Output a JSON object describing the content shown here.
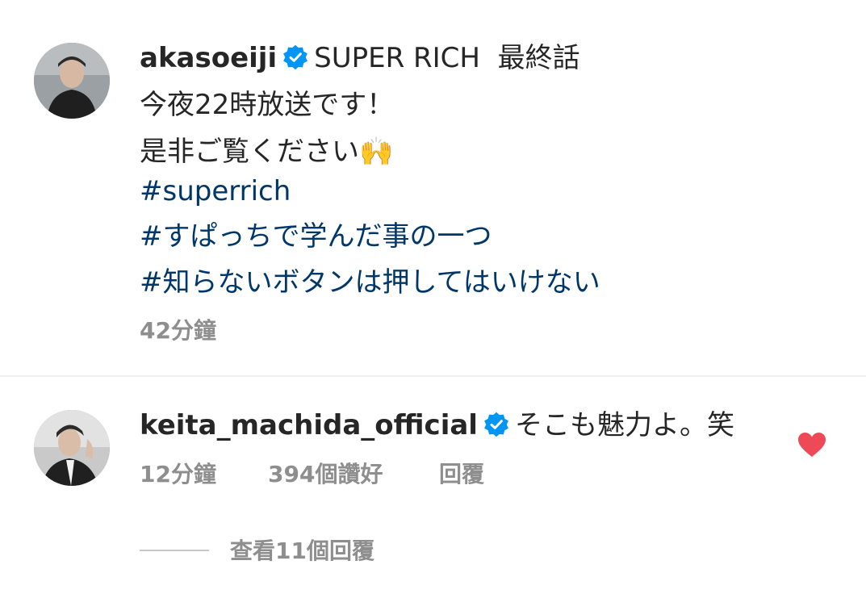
{
  "caption": {
    "username": "akasoeiji",
    "title_text": "SUPER RICH  最終話",
    "line2": "今夜22時放送です！",
    "line3": "是非ご覧ください🙌",
    "hashtags": [
      "#superrich",
      "#すぱっちで学んだ事の一つ",
      "#知らないボタンは押してはいけない"
    ],
    "time": "42分鐘"
  },
  "comment": {
    "username": "keita_machida_official",
    "text": "そこも魅力よ。笑",
    "time": "12分鐘",
    "likes": "394個讚好",
    "reply_label": "回覆",
    "view_replies": "查看11個回覆"
  },
  "colors": {
    "text": "#262626",
    "hashtag": "#00376b",
    "meta": "#8e8e8e",
    "verified": "#0095f6",
    "heart": "#ed4956",
    "divider": "#efefef"
  },
  "icons": {
    "verified": "verified-badge-icon",
    "heart": "heart-icon"
  }
}
